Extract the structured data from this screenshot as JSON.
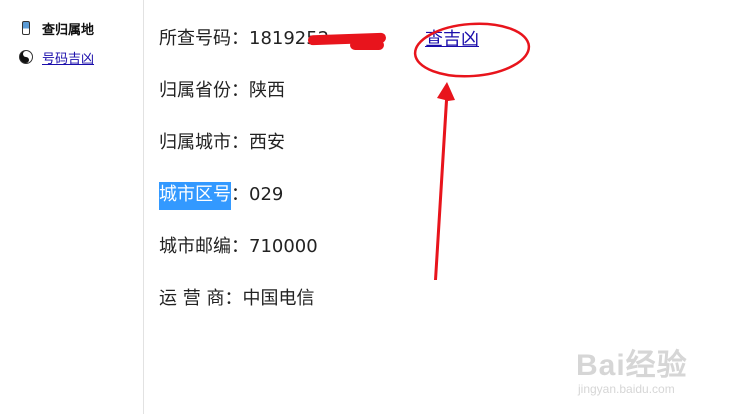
{
  "sidebar": {
    "items": [
      {
        "icon": "mobile-phone-icon",
        "label": "查归属地"
      },
      {
        "icon": "yin-yang-icon",
        "label": "号码吉凶"
      }
    ]
  },
  "result": {
    "phone": {
      "label": "所查号码：",
      "value": "1819252"
    },
    "province": {
      "label": "归属省份：",
      "value": "陕西"
    },
    "city": {
      "label": "归属城市：",
      "value": "西安"
    },
    "area_code": {
      "label": "城市区号",
      "sep": "：",
      "value": "029"
    },
    "postcode": {
      "label": "城市邮编：",
      "value": "710000"
    },
    "carrier": {
      "label": "运 营 商：",
      "value": "中国电信"
    }
  },
  "luck_link": "查吉凶",
  "watermark": {
    "brand": "Bai经验",
    "site": "jingyan.baidu.com"
  },
  "colors": {
    "annotation": "#e8141c",
    "link": "#1a0dab",
    "selection": "#3399ff"
  }
}
